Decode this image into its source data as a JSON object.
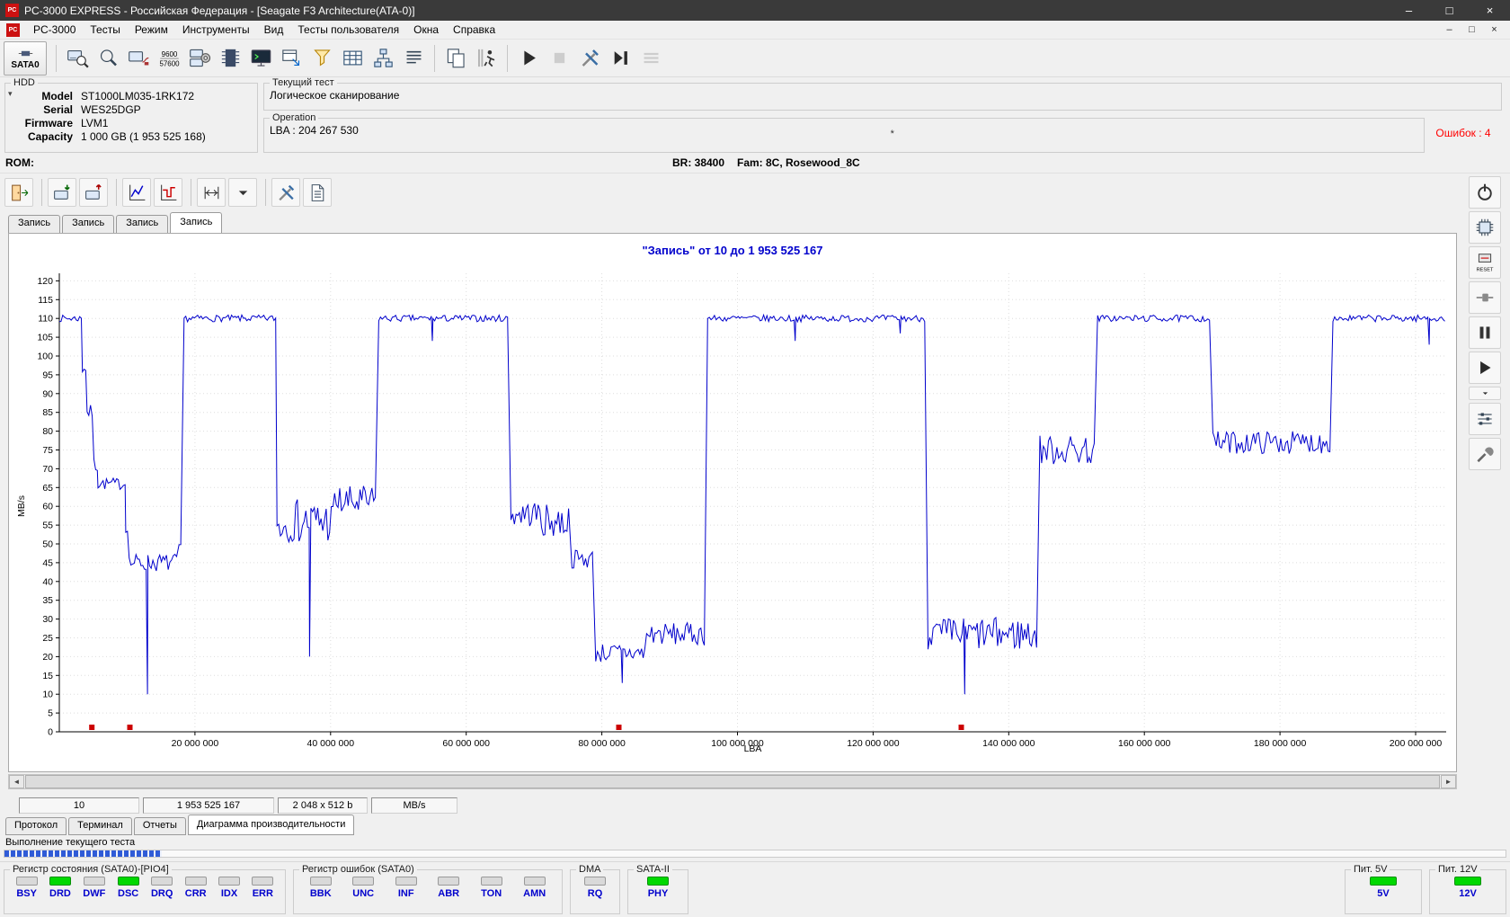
{
  "window": {
    "title": "PC-3000 EXPRESS - Российская Федерация - [Seagate F3 Architecture(ATA-0)]"
  },
  "menubar": {
    "items": [
      {
        "id": "pc3000",
        "label": "PC-3000"
      },
      {
        "id": "tests",
        "label": "Тесты"
      },
      {
        "id": "mode",
        "label": "Режим"
      },
      {
        "id": "tools",
        "label": "Инструменты"
      },
      {
        "id": "view",
        "label": "Вид"
      },
      {
        "id": "user-tests",
        "label": "Тесты пользователя"
      },
      {
        "id": "windows",
        "label": "Окна"
      },
      {
        "id": "help",
        "label": "Справка"
      }
    ]
  },
  "toolbar_main": {
    "items": [
      {
        "name": "sata0-port-button",
        "icon": "sata-connector",
        "label": "SATA0"
      },
      {
        "sep": true
      },
      {
        "name": "drive-id-button",
        "icon": "drive-magnifier"
      },
      {
        "name": "search-button",
        "icon": "magnifier"
      },
      {
        "name": "drive-init-button",
        "icon": "drive-cable"
      },
      {
        "name": "baud-rate-button",
        "icon": "baud-rate"
      },
      {
        "name": "drive-settings-button",
        "icon": "drive-gear"
      },
      {
        "name": "memory-chip-button",
        "icon": "memory-chip"
      },
      {
        "name": "terminal-button",
        "icon": "terminal"
      },
      {
        "name": "send-command-button",
        "icon": "window-arrow"
      },
      {
        "name": "filter-button",
        "icon": "funnel"
      },
      {
        "name": "sector-view-button",
        "icon": "grid"
      },
      {
        "name": "scheme-button",
        "icon": "tree-scheme"
      },
      {
        "name": "report-button",
        "icon": "report-lines"
      },
      {
        "sep": true
      },
      {
        "name": "copy-button",
        "icon": "copy"
      },
      {
        "name": "active-tasks-button",
        "icon": "running-man"
      },
      {
        "sep": true
      },
      {
        "name": "start-test-button",
        "icon": "play"
      },
      {
        "name": "stop-test-button",
        "icon": "stop",
        "disabled": true
      },
      {
        "name": "test-settings-button",
        "icon": "tools"
      },
      {
        "name": "go-to-end-button",
        "icon": "step-forward"
      },
      {
        "name": "task-list-button",
        "icon": "menu-lines",
        "disabled": true
      }
    ]
  },
  "toolbar_graph": {
    "items": [
      {
        "name": "exit-graph-button",
        "icon": "exit-door"
      },
      {
        "sep": true
      },
      {
        "name": "save-graph-button",
        "icon": "drive-import"
      },
      {
        "name": "load-graph-button",
        "icon": "drive-export"
      },
      {
        "sep": true
      },
      {
        "name": "line-graph-button",
        "icon": "line-chart"
      },
      {
        "name": "step-graph-button",
        "icon": "step-chart"
      },
      {
        "sep": true
      },
      {
        "name": "range-button",
        "icon": "range"
      },
      {
        "name": "range-dropdown-button",
        "icon": "chevron-down"
      },
      {
        "sep": true
      },
      {
        "name": "graph-settings-button",
        "icon": "tools"
      },
      {
        "name": "graph-report-button",
        "icon": "document-page"
      }
    ]
  },
  "right_toolbar": {
    "items": [
      {
        "name": "power-button",
        "icon": "power"
      },
      {
        "name": "firmware-chip-button",
        "icon": "chip-pins"
      },
      {
        "name": "reset-button",
        "icon": "reset"
      },
      {
        "name": "connect-button",
        "icon": "plug"
      },
      {
        "name": "pause-test-button",
        "icon": "pause"
      },
      {
        "name": "run-test-button",
        "icon": "play-small"
      },
      {
        "name": "run-dropdown-button",
        "icon": "chevron-down",
        "small": true
      },
      {
        "name": "levels-button",
        "icon": "sliders"
      },
      {
        "name": "utility-settings-button",
        "icon": "wrench"
      }
    ]
  },
  "hdd": {
    "box_title": "HDD",
    "fields": [
      {
        "label": "Model",
        "value": "ST1000LM035-1RK172"
      },
      {
        "label": "Serial",
        "value": "WES25DGP"
      },
      {
        "label": "Firmware",
        "value": "LVM1"
      },
      {
        "label": "Capacity",
        "value": "1 000 GB (1 953 525 168)"
      }
    ]
  },
  "current_test": {
    "box_title": "Текущий тест",
    "test_name": "Логическое сканирование",
    "operation_box_title": "Operation",
    "operation_value": "LBA : 204 267 530",
    "note": "*",
    "errors_label": "Ошибок : 4"
  },
  "rom_row": {
    "label": "ROM:",
    "br": "BR: 38400",
    "fam": "Fam: 8C, Rosewood_8C"
  },
  "tabs": {
    "items": [
      "Запись",
      "Запись",
      "Запись",
      "Запись"
    ],
    "active_index": 3
  },
  "chart_data": {
    "type": "line",
    "title": "\"Запись\" от 10 до 1 953 525 167",
    "xlabel": "LBA",
    "ylabel": "MB/s",
    "xlim": [
      0,
      204500000
    ],
    "ylim": [
      0,
      122
    ],
    "y_tick_step": 5,
    "y_max_tick": 120,
    "grid": true,
    "line_color": "#0000cc",
    "error_marker_color": "#cc0000",
    "x_ticks": [
      {
        "v": 20000000,
        "label": "20 000 000"
      },
      {
        "v": 40000000,
        "label": "40 000 000"
      },
      {
        "v": 60000000,
        "label": "60 000 000"
      },
      {
        "v": 80000000,
        "label": "80 000 000"
      },
      {
        "v": 100000000,
        "label": "100 000 000"
      },
      {
        "v": 120000000,
        "label": "120 000 000"
      },
      {
        "v": 140000000,
        "label": "140 000 000"
      },
      {
        "v": 160000000,
        "label": "160 000 000"
      },
      {
        "v": 180000000,
        "label": "180 000 000"
      },
      {
        "v": 200000000,
        "label": "200 000 000"
      }
    ],
    "segments": [
      {
        "from": 0,
        "to": 3300000,
        "level": 110,
        "amp": 0.9
      },
      {
        "from": 3400000,
        "to": 4000000,
        "level": 97,
        "amp": 2
      },
      {
        "from": 4100000,
        "to": 5000000,
        "level": 85,
        "amp": 2
      },
      {
        "from": 5100000,
        "to": 5600000,
        "level": 71,
        "amp": 2
      },
      {
        "from": 5700000,
        "to": 9700000,
        "level": 66,
        "amp": 1.6
      },
      {
        "from": 9800000,
        "to": 10200000,
        "level": 55,
        "amp": 2
      },
      {
        "from": 10300000,
        "to": 17300000,
        "level": 45,
        "amp": 2.4
      },
      {
        "from": 17400000,
        "to": 18100000,
        "level": 47,
        "amp": 3
      },
      {
        "from": 18400000,
        "to": 31900000,
        "level": 110,
        "amp": 0.9
      },
      {
        "from": 32100000,
        "to": 34500000,
        "level": 55,
        "amp": 4.5
      },
      {
        "from": 34600000,
        "to": 40500000,
        "level": 56,
        "amp": 6
      },
      {
        "from": 40600000,
        "to": 46800000,
        "level": 61,
        "amp": 4.5
      },
      {
        "from": 47100000,
        "to": 66300000,
        "level": 110,
        "amp": 0.9
      },
      {
        "from": 66600000,
        "to": 71000000,
        "level": 58,
        "amp": 3.5
      },
      {
        "from": 71100000,
        "to": 75300000,
        "level": 56,
        "amp": 4.5
      },
      {
        "from": 75600000,
        "to": 78800000,
        "level": 46,
        "amp": 2.6
      },
      {
        "from": 79100000,
        "to": 86500000,
        "level": 21,
        "amp": 2.6
      },
      {
        "from": 86600000,
        "to": 95300000,
        "level": 26,
        "amp": 3
      },
      {
        "from": 95600000,
        "to": 127800000,
        "level": 110,
        "amp": 0.9
      },
      {
        "from": 128100000,
        "to": 144300000,
        "level": 26,
        "amp": 4.5
      },
      {
        "from": 144600000,
        "to": 152800000,
        "level": 75,
        "amp": 4
      },
      {
        "from": 153100000,
        "to": 169800000,
        "level": 110,
        "amp": 0.9
      },
      {
        "from": 170100000,
        "to": 187400000,
        "level": 77,
        "amp": 3
      },
      {
        "from": 187800000,
        "to": 204300000,
        "level": 110,
        "amp": 0.9
      }
    ],
    "dips": [
      {
        "x": 13000000,
        "y": 10
      },
      {
        "x": 36900000,
        "y": 20
      },
      {
        "x": 55000000,
        "y": 104
      },
      {
        "x": 83000000,
        "y": 13
      },
      {
        "x": 108500000,
        "y": 104
      },
      {
        "x": 124000000,
        "y": 106
      },
      {
        "x": 133500000,
        "y": 10
      },
      {
        "x": 202000000,
        "y": 103
      }
    ],
    "error_lbas": [
      4800000,
      10400000,
      82500000,
      133000000
    ]
  },
  "status_boxes": [
    {
      "id": "start-lba",
      "value": "10"
    },
    {
      "id": "end-lba",
      "value": "1 953 525 167"
    },
    {
      "id": "block-size",
      "value": "2 048 x 512 b"
    },
    {
      "id": "units",
      "value": "MB/s"
    }
  ],
  "bottom_tabs": {
    "items": [
      {
        "id": "protocol",
        "label": "Протокол"
      },
      {
        "id": "terminal",
        "label": "Терминал"
      },
      {
        "id": "reports",
        "label": "Отчеты"
      },
      {
        "id": "performance-diagram",
        "label": "Диаграмма производительности"
      }
    ],
    "active_index": 3
  },
  "progress": {
    "label": "Выполнение текущего теста",
    "percent": 10.5
  },
  "registers": {
    "status": {
      "title": "Регистр состояния (SATA0)-[PIO4]",
      "leds": [
        {
          "label": "BSY",
          "on": false
        },
        {
          "label": "DRD",
          "on": true
        },
        {
          "label": "DWF",
          "on": false
        },
        {
          "label": "DSC",
          "on": true
        },
        {
          "label": "DRQ",
          "on": false
        },
        {
          "label": "CRR",
          "on": false
        },
        {
          "label": "IDX",
          "on": false
        },
        {
          "label": "ERR",
          "on": false
        }
      ]
    },
    "errors": {
      "title": "Регистр ошибок  (SATA0)",
      "leds": [
        {
          "label": "BBK",
          "on": false
        },
        {
          "label": "UNC",
          "on": false
        },
        {
          "label": "INF",
          "on": false
        },
        {
          "label": "ABR",
          "on": false
        },
        {
          "label": "TON",
          "on": false
        },
        {
          "label": "AMN",
          "on": false
        }
      ]
    },
    "dma": {
      "title": "DMA",
      "leds": [
        {
          "label": "RQ",
          "on": false
        }
      ]
    },
    "sata": {
      "title": "SATA-II",
      "leds": [
        {
          "label": "PHY",
          "on": true
        }
      ]
    },
    "power5": {
      "title": "Пит. 5V",
      "leds": [
        {
          "label": "5V",
          "on": true
        }
      ]
    },
    "power12": {
      "title": "Пит. 12V",
      "leds": [
        {
          "label": "12V",
          "on": true
        }
      ]
    }
  },
  "colors": {
    "chart_line": "#0000cc",
    "chart_title": "#0000cc",
    "error_text": "#ff0000",
    "led_on": "#00d800",
    "label_blue": "#0000cc"
  }
}
